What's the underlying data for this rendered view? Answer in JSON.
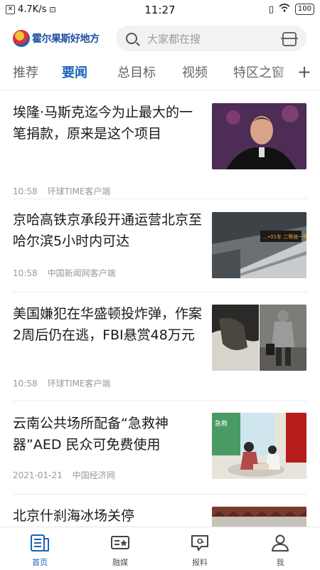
{
  "status_bar": {
    "speed": "4.7K/s",
    "time": "11:27",
    "battery": "100"
  },
  "header": {
    "logo_text": "霍尔果斯好地方",
    "search_placeholder": "大家都在搜"
  },
  "tabs": [
    {
      "label": "推荐",
      "active": false
    },
    {
      "label": "要闻",
      "active": true
    },
    {
      "label": "总目标",
      "active": false
    },
    {
      "label": "视频",
      "active": false
    },
    {
      "label": "特区之窗",
      "active": false
    }
  ],
  "articles": [
    {
      "title": "埃隆·马斯克迄今为止最大的一笔捐款，原来是这个项目",
      "time": "10:58",
      "source": "环球TIME客户端"
    },
    {
      "title": "京哈高铁京承段开通运营北京至哈尔滨5小时内可达",
      "time": "10:58",
      "source": "中国新闻网客户端",
      "thumb_text": "…•01车 二等座一等座"
    },
    {
      "title": "美国嫌犯在华盛顿投炸弹，作案2周后仍在逃，FBI悬赏48万元",
      "time": "10:58",
      "source": "环球TIME客户端"
    },
    {
      "title": "云南公共场所配备“急救神器”AED 民众可免费使用",
      "time": "2021-01-21",
      "source": "中国经济网",
      "thumb_text": "急救"
    },
    {
      "title": "北京什刹海冰场关停",
      "time": "",
      "source": ""
    }
  ],
  "bottom_nav": [
    {
      "label": "首页",
      "icon": "news-icon",
      "active": true
    },
    {
      "label": "融媒",
      "icon": "media-card-icon",
      "active": false
    },
    {
      "label": "报料",
      "icon": "report-chat-icon",
      "active": false
    },
    {
      "label": "我",
      "icon": "person-icon",
      "active": false
    }
  ],
  "colors": {
    "accent": "#1b63b6"
  }
}
